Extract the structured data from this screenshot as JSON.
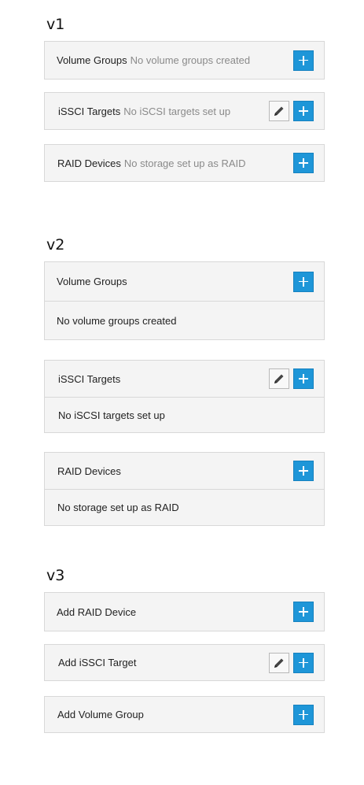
{
  "v1": {
    "heading": "v1",
    "panels": [
      {
        "title": "Volume Groups",
        "empty": "No volume groups created"
      },
      {
        "title": "iSSCI Targets",
        "empty": "No iSCSI targets set up"
      },
      {
        "title": "RAID Devices",
        "empty": "No storage set up as RAID"
      }
    ]
  },
  "v2": {
    "heading": "v2",
    "panels": [
      {
        "title": "Volume Groups",
        "empty": "No volume groups created"
      },
      {
        "title": "iSSCI Targets",
        "empty": "No iSCSI targets set up"
      },
      {
        "title": "RAID Devices",
        "empty": "No storage set up as RAID"
      }
    ]
  },
  "v3": {
    "heading": "v3",
    "panels": [
      {
        "title": "Add RAID Device"
      },
      {
        "title": "Add iSSCI Target"
      },
      {
        "title": "Add Volume Group"
      }
    ]
  },
  "icons": {
    "add": "plus-icon",
    "edit": "pencil-icon"
  },
  "colors": {
    "add_button": "#1e96d8",
    "panel_bg": "#f4f4f4",
    "empty_text": "#8a8a8a"
  }
}
